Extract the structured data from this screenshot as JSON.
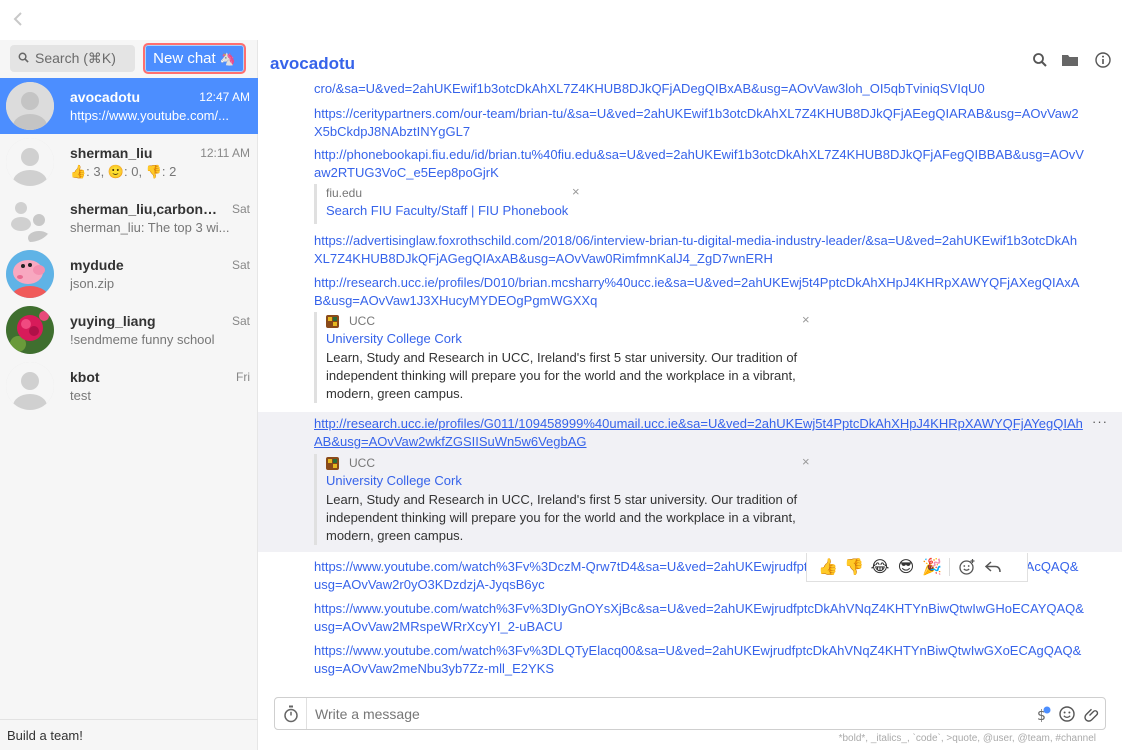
{
  "sidebar": {
    "search_label": "Search (⌘K)",
    "new_chat_label": "New chat",
    "new_chat_emoji": "🦄",
    "footer": "Build a team!",
    "conversations": [
      {
        "name": "avocadotu",
        "time": "12:47 AM",
        "snippet": "https://www.youtube.com/...",
        "selected": true
      },
      {
        "name": "sherman_liu",
        "time": "12:11 AM",
        "snippet": "👍: 3, 🙂: 0, 👎: 2"
      },
      {
        "name": "sherman_liu,carbonic...",
        "time": "Sat",
        "snippet": "sherman_liu: The top 3 wi..."
      },
      {
        "name": "mydude",
        "time": "Sat",
        "snippet": "json.zip"
      },
      {
        "name": "yuying_liang",
        "time": "Sat",
        "snippet": "!sendmeme funny school"
      },
      {
        "name": "kbot",
        "time": "Fri",
        "snippet": "test"
      }
    ]
  },
  "header": {
    "title": "avocadotu"
  },
  "messages": {
    "m1": "cro/&sa=U&ved=2ahUKEwif1b3otcDkAhXL7Z4KHUB8DJkQFjADegQIBxAB&usg=AOvVaw3loh_OI5qbTviniqSVIqU0",
    "m2": "https://ceritypartners.com/our-team/brian-tu/&sa=U&ved=2ahUKEwif1b3otcDkAhXL7Z4KHUB8DJkQFjAEegQIARAB&usg=AOvVaw2X5bCkdpJ8NAbztINYgGL7",
    "m3": "http://phonebookapi.fiu.edu/id/brian.tu%40fiu.edu&sa=U&ved=2ahUKEwif1b3otcDkAhXL7Z4KHUB8DJkQFjAFegQIBBAB&usg=AOvVaw2RTUG3VoC_e5Eep8poGjrK",
    "p3_site": "fiu.edu",
    "p3_title": "Search FIU Faculty/Staff | FIU Phonebook",
    "m4": "https://advertisinglaw.foxrothschild.com/2018/06/interview-brian-tu-digital-media-industry-leader/&sa=U&ved=2ahUKEwif1b3otcDkAhXL7Z4KHUB8DJkQFjAGegQIAxAB&usg=AOvVaw0RimfmnKalJ4_ZgD7wnERH",
    "m5": "http://research.ucc.ie/profiles/D010/brian.mcsharry%40ucc.ie&sa=U&ved=2ahUKEwj5t4PptcDkAhXHpJ4KHRpXAWYQFjAXegQIAxAB&usg=AOvVaw1J3XHucyMYDEOgPgmWGXXq",
    "p5_site": "UCC",
    "p5_title": "University College Cork",
    "p5_desc": "Learn, Study and Research in UCC, Ireland's first 5 star university. Our tradition of independent thinking will prepare you for the world and the workplace in a vibrant, modern, green campus.",
    "m6": "http://research.ucc.ie/profiles/G011/109458999%40umail.ucc.ie&sa=U&ved=2ahUKEwj5t4PptcDkAhXHpJ4KHRpXAWYQFjAYegQIAhAB&usg=AOvVaw2wkfZGSIISuWn5w6VegbAG",
    "m6_menu": "···",
    "p6_site": "UCC",
    "p6_title": "University College Cork",
    "p6_desc": "Learn, Study and Research in UCC, Ireland's first 5 star university. Our tradition of independent thinking will prepare you for the world and the workplace in a vibrant, modern, green campus.",
    "m7": "https://www.youtube.com/watch%3Fv%3DczM-Qrw7tD4&sa=U&ved=2ahUKEwjrudfptcDkAhVNqZ4KHTYnBiwQtwIwF3oECAcQAQ&usg=AOvVaw2r0yO3KDzdzjA-JyqsB6yc",
    "m8": "https://www.youtube.com/watch%3Fv%3DIyGnOYsXjBc&sa=U&ved=2ahUKEwjrudfptcDkAhVNqZ4KHTYnBiwQtwIwGHoECAYQAQ&usg=AOvVaw2MRspeWRrXcyYI_2-uBACU",
    "m9": "https://www.youtube.com/watch%3Fv%3DLQTyElacq00&sa=U&ved=2ahUKEwjrudfptcDkAhVNqZ4KHTYnBiwQtwIwGXoECAgQAQ&usg=AOvVaw2meNbu3yb7Zz-mll_E2YKS",
    "close_glyph": "×"
  },
  "reactions": [
    "👍",
    "👎",
    "😂",
    "😎",
    "🎉"
  ],
  "composer": {
    "placeholder": "Write a message",
    "format_hint": "*bold*, _italics_, `code`, >quote, @user, @team, #channel"
  },
  "colors": {
    "accent": "#4c8eff",
    "link": "#3663ea"
  },
  "icons": [
    "back-arrow-icon",
    "search-icon",
    "folder-icon",
    "info-icon",
    "timer-icon",
    "money-icon",
    "emoji-icon",
    "attachment-icon",
    "add-reaction-icon",
    "reply-icon"
  ]
}
